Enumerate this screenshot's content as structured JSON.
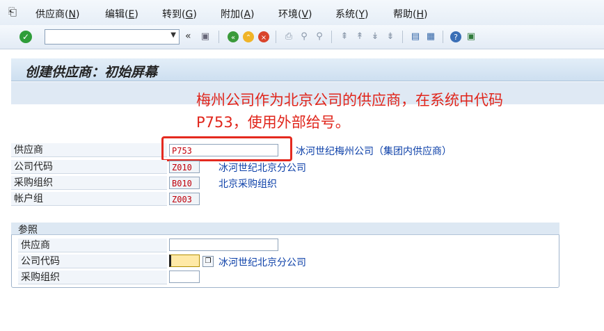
{
  "menu": [
    {
      "label": "供应商(",
      "key": "N",
      "close": ")"
    },
    {
      "label": "编辑(",
      "key": "E",
      "close": ")"
    },
    {
      "label": "转到(",
      "key": "G",
      "close": ")"
    },
    {
      "label": "附加(",
      "key": "A",
      "close": ")"
    },
    {
      "label": "环境(",
      "key": "V",
      "close": ")"
    },
    {
      "label": "系统(",
      "key": "Y",
      "close": ")"
    },
    {
      "label": "帮助(",
      "key": "H",
      "close": ")"
    }
  ],
  "toolbar": {
    "back_glyph": "«",
    "command_value": "",
    "dropdown_glyph": "▼"
  },
  "title": "创建供应商：初始屏幕",
  "annotation": {
    "line1": "梅州公司作为北京公司的供应商，在系统中代码",
    "line2": "P753，使用外部给号。"
  },
  "fields": {
    "vendor": {
      "label": "供应商",
      "value": "P753",
      "desc": "冰河世纪梅州公司（集团内供应商）"
    },
    "company_code": {
      "label": "公司代码",
      "value": "Z010",
      "desc": "冰河世纪北京分公司"
    },
    "purch_org": {
      "label": "采购组织",
      "value": "B010",
      "desc": "北京采购组织"
    },
    "account_group": {
      "label": "帐户组",
      "value": "Z003"
    }
  },
  "reference": {
    "title": "参照",
    "vendor_label": "供应商",
    "vendor_value": "",
    "company_code_label": "公司代码",
    "company_code_value": "",
    "company_code_desc": "冰河世纪北京分公司",
    "purch_org_label": "采购组织",
    "purch_org_value": ""
  }
}
